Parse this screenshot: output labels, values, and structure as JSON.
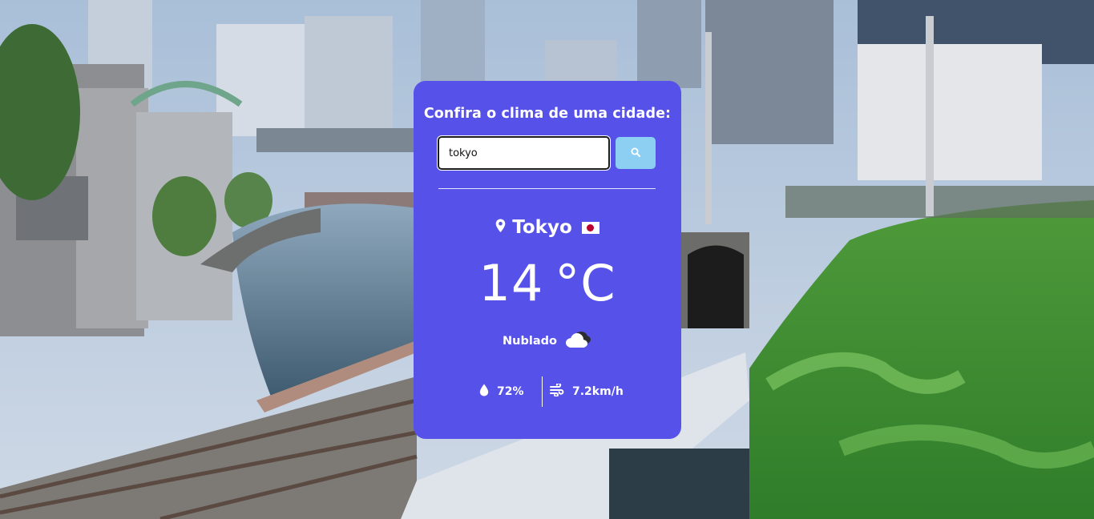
{
  "form": {
    "title": "Confira o clima de uma cidade:",
    "search_value": "tokyo",
    "search_icon": "search-icon"
  },
  "weather": {
    "city": "Tokyo",
    "country_flag": "japan-flag",
    "temperature": "14",
    "unit": "°C",
    "condition": "Nublado",
    "condition_icon": "cloud-icon",
    "humidity": "72%",
    "humidity_icon": "droplet-icon",
    "wind": "7.2km/h",
    "wind_icon": "wind-icon"
  },
  "colors": {
    "card": "#5651e9",
    "search_button": "#8ccff2",
    "text": "#ffffff",
    "flag_red": "#bc002d"
  }
}
